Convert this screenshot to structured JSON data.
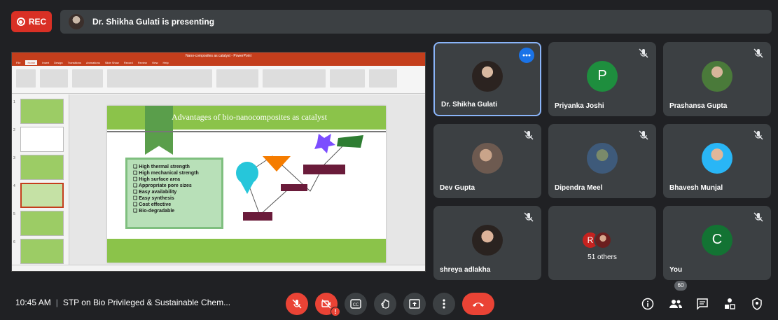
{
  "recording": {
    "label": "REC",
    "color": "#d93025"
  },
  "presenting_banner": {
    "text": "Dr. Shikha Gulati is presenting"
  },
  "shared_screen": {
    "window_title": "Nano-composites as catalyst - PowerPoint",
    "ribbon_tabs": [
      "File",
      "Home",
      "Insert",
      "Design",
      "Transitions",
      "Animations",
      "Slide Show",
      "Record",
      "Review",
      "View",
      "Help"
    ],
    "active_tab": "Home",
    "slide_title": "Advantages of bio-nanocomposites as catalyst",
    "bullets": [
      "❏ High thermal strength",
      "❏ High mechanical strength",
      "❏ High surface area",
      "❏ Appropriate pore sizes",
      "❏ Easy availability",
      "❏ Easy synthesis",
      "❏ Cost effective",
      "❏ Bio-degradable"
    ],
    "thumbnail_numbers": [
      "1",
      "2",
      "3",
      "4",
      "5",
      "6"
    ]
  },
  "participants": [
    {
      "name": "Dr. Shikha Gulati",
      "initial": "",
      "color": "",
      "photo": true,
      "muted": false,
      "active": true
    },
    {
      "name": "Priyanka Joshi",
      "initial": "P",
      "color": "#1e8e3e",
      "photo": false,
      "muted": true,
      "active": false
    },
    {
      "name": "Prashansa Gupta",
      "initial": "",
      "color": "",
      "photo": true,
      "muted": true,
      "active": false
    },
    {
      "name": "Dev Gupta",
      "initial": "",
      "color": "",
      "photo": true,
      "muted": true,
      "active": false
    },
    {
      "name": "Dipendra Meel",
      "initial": "",
      "color": "",
      "photo": true,
      "muted": true,
      "active": false
    },
    {
      "name": "Bhavesh Munjal",
      "initial": "",
      "color": "",
      "photo": true,
      "muted": true,
      "active": false
    },
    {
      "name": "shreya adlakha",
      "initial": "",
      "color": "",
      "photo": true,
      "muted": true,
      "active": false
    },
    {
      "name": "You",
      "initial": "C",
      "color": "#137333",
      "photo": false,
      "muted": true,
      "active": false
    }
  ],
  "others_tile": {
    "text": "51 others",
    "initial": "R",
    "color": "#c5221f"
  },
  "bottom_bar": {
    "time": "10:45 AM",
    "meeting_name": "STP on Bio Privileged & Sustainable Chem...",
    "participant_count": "60",
    "camera_alert": "!"
  },
  "icons": [
    "mic-off-icon",
    "camera-off-icon",
    "captions-icon",
    "raise-hand-icon",
    "present-icon",
    "more-options-icon",
    "hang-up-icon",
    "info-icon",
    "people-icon",
    "chat-icon",
    "activities-icon",
    "host-controls-icon"
  ]
}
